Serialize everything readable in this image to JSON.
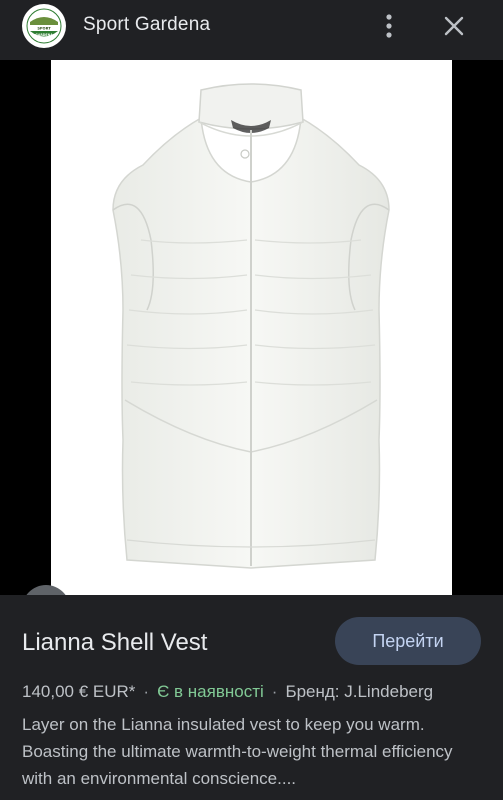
{
  "header": {
    "site_name": "Sport Gardena",
    "logo_text": "SPORT GARDENA"
  },
  "icons": {
    "more": "more-vertical-icon",
    "close": "close-icon",
    "lens": "google-lens-icon"
  },
  "product": {
    "title": "Lianna Shell Vest",
    "go_label": "Перейти",
    "price": "140,00 € EUR*",
    "availability": "Є в наявності",
    "brand": "Бренд: J.Lindeberg",
    "description": "Layer on the Lianna insulated vest to keep you warm. Boasting the ultimate warmth-to-weight thermal efficiency with an environmental conscience...."
  },
  "colors": {
    "background": "#202124",
    "button_bg": "#394457",
    "button_text": "#c4d4f2",
    "in_stock": "#81c995"
  }
}
